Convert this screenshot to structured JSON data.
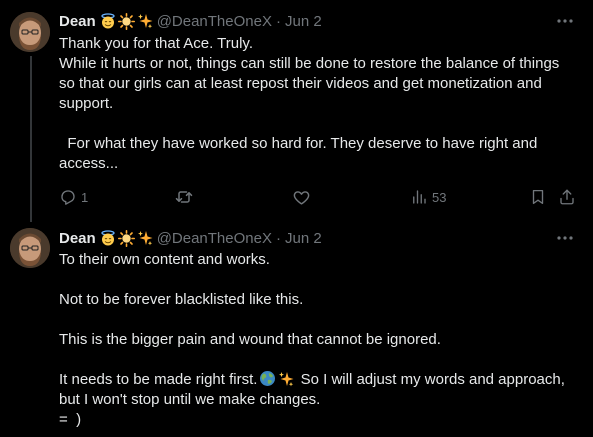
{
  "tweets": [
    {
      "author": {
        "name": "Dean",
        "name_emojis": [
          "halo-face-emoji",
          "sun-emoji",
          "sparkles-emoji"
        ],
        "handle": "@DeanTheOneX",
        "separator": "·",
        "date": "Jun 2"
      },
      "text": {
        "line1": "Thank you for that Ace. Truly.",
        "para1": "While it hurts or not, things can still be done to restore the balance of things so that our girls can at least repost their videos and get monetization and support.",
        "para2": "  For what they have worked so hard for. They deserve to have right and access..."
      },
      "actions": {
        "replies": "1",
        "reposts": "",
        "likes": "",
        "views": "53"
      }
    },
    {
      "author": {
        "name": "Dean",
        "name_emojis": [
          "halo-face-emoji",
          "sun-emoji",
          "sparkles-emoji"
        ],
        "handle": "@DeanTheOneX",
        "separator": "·",
        "date": "Jun 2"
      },
      "text": {
        "line1": "To their own content and works.",
        "line2": "Not to be forever blacklisted like this.",
        "line3": "This is the bigger pain and wound that cannot be ignored.",
        "line4_pre": "It needs to be made right first.",
        "line4_emojis": [
          "globe-emoji",
          "sparkles-emoji"
        ],
        "line4_post": " So I will adjust my words and approach, but I won't stop until we make changes.",
        "line5": "=  )"
      }
    }
  ],
  "colors": {
    "background": "#000000",
    "text_primary": "#e7e9ea",
    "text_secondary": "#71767b",
    "thread_line": "#333639"
  }
}
